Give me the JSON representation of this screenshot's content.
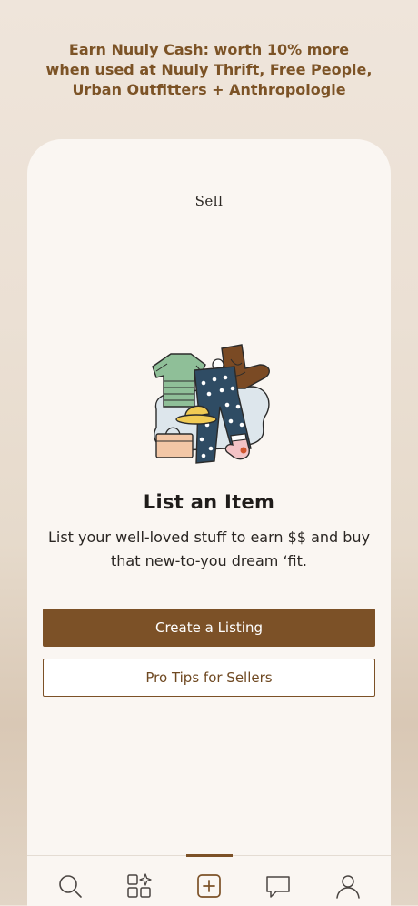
{
  "promo": {
    "line1": "Earn Nuuly Cash: worth 10% more",
    "line2": "when used at Nuuly Thrift, Free People,",
    "line3": "Urban Outfitters + Anthropologie"
  },
  "page": {
    "title": "Sell"
  },
  "content": {
    "heading": "List an Item",
    "description_line1": "List your well-loved stuff to earn $$ and buy",
    "description_line2": "that new-to-you dream ‘fit."
  },
  "buttons": {
    "primary_label": "Create a Listing",
    "secondary_label": "Pro Tips for Sellers"
  },
  "nav": {
    "items": [
      {
        "icon": "search-icon",
        "active": false
      },
      {
        "icon": "browse-grid-icon",
        "active": false
      },
      {
        "icon": "sell-plus-icon",
        "active": true
      },
      {
        "icon": "messages-icon",
        "active": false
      },
      {
        "icon": "profile-icon",
        "active": false
      }
    ]
  },
  "colors": {
    "brand_brown": "#7c5127",
    "promo_text": "#7c5326",
    "card_bg": "#faf6f2"
  }
}
